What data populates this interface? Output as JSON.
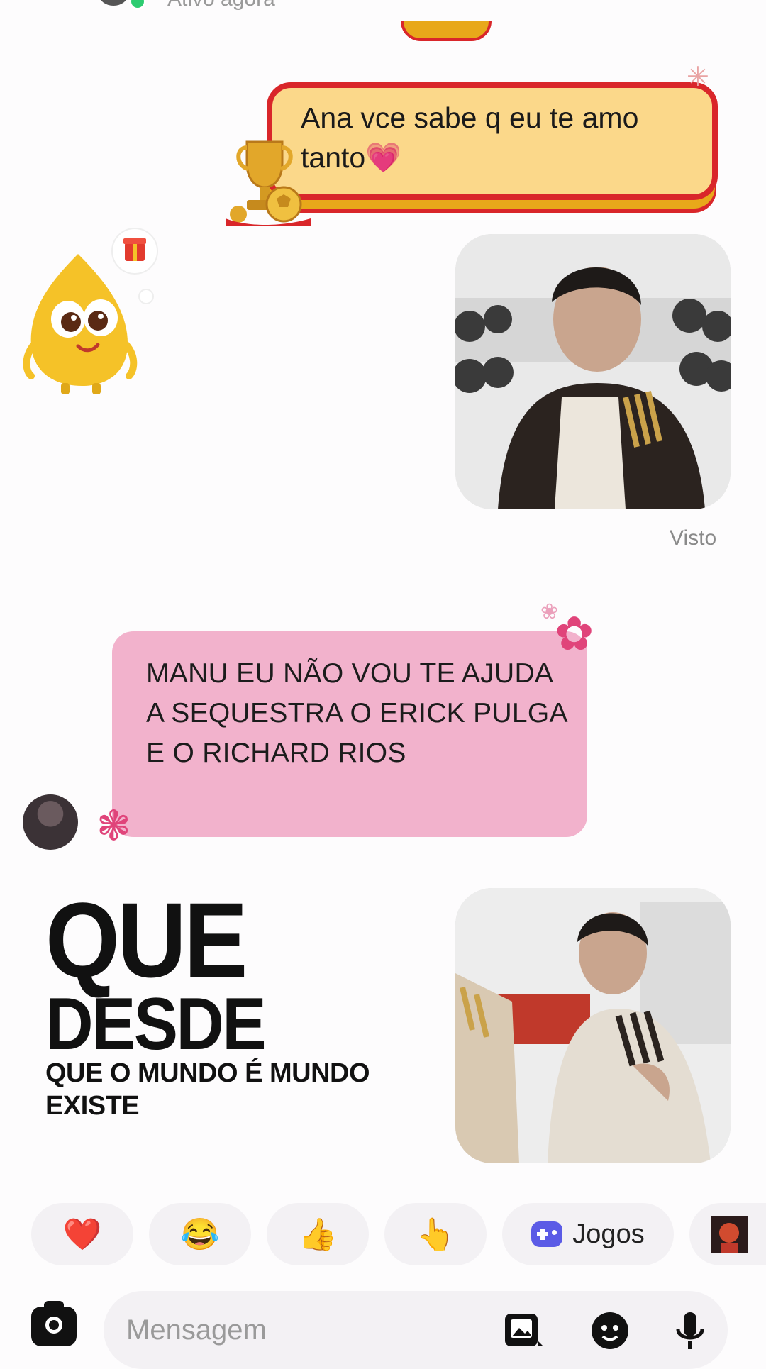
{
  "header": {
    "status_text": "Ativo agora"
  },
  "messages": {
    "sent_text": "Ana vce sabe q eu te amo tanto💗",
    "seen_label": "Visto",
    "received_text": "MANU EU NÃO VOU TE AJUDA A SEQUESTRA O ERICK PULGA E O RICHARD RIOS"
  },
  "overlay_caption": {
    "line1": "QUE",
    "line2": "DESDE",
    "line3": "QUE O MUNDO É MUNDO EXISTE"
  },
  "quick_reactions": {
    "heart": "❤️",
    "laugh": "😂",
    "thumbs": "👍",
    "point": "👆",
    "games_label": "Jogos"
  },
  "composer": {
    "placeholder": "Mensagem"
  },
  "colors": {
    "gold_bubble": "#fbd88a",
    "gold_border": "#d9262a",
    "pink_bubble": "#f2b2cc",
    "accent_flower": "#e0447a",
    "games_icon": "#5b5be6"
  }
}
